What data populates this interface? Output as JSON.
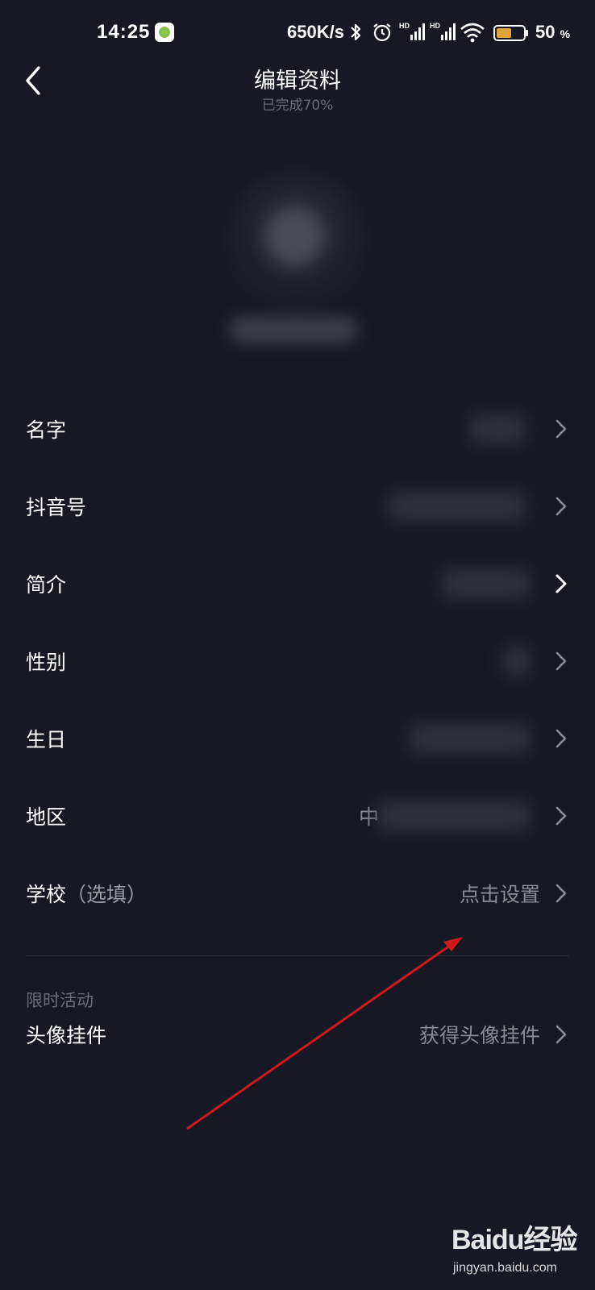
{
  "status_bar": {
    "time": "14:25",
    "net_speed": "650K/s",
    "battery_percent": "50",
    "battery_unit": "%",
    "icons": [
      "app-badge-icon",
      "bluetooth-icon",
      "alarm-icon",
      "hd-signal-icon",
      "hd-signal-icon",
      "wifi-icon",
      "battery-icon"
    ]
  },
  "header": {
    "title": "编辑资料",
    "subtitle": "已完成70%"
  },
  "profile_rows": [
    {
      "label": "名字",
      "value": ""
    },
    {
      "label": "抖音号",
      "value": ""
    },
    {
      "label": "简介",
      "value": ""
    },
    {
      "label": "性别",
      "value": ""
    },
    {
      "label": "生日",
      "value": ""
    },
    {
      "label": "地区",
      "value": "中"
    },
    {
      "label": "学校",
      "label_suffix": "（选填）",
      "value": "点击设置"
    }
  ],
  "limited_section": {
    "label": "限时活动",
    "row": {
      "label": "头像挂件",
      "value": "获得头像挂件"
    }
  },
  "watermark": {
    "logo_text": "Baidu经验",
    "url": "jingyan.baidu.com"
  },
  "colors": {
    "background": "#161823",
    "primary_text": "#ffffff",
    "secondary_text": "#8a8c94",
    "annotation_arrow": "#d0191c"
  }
}
